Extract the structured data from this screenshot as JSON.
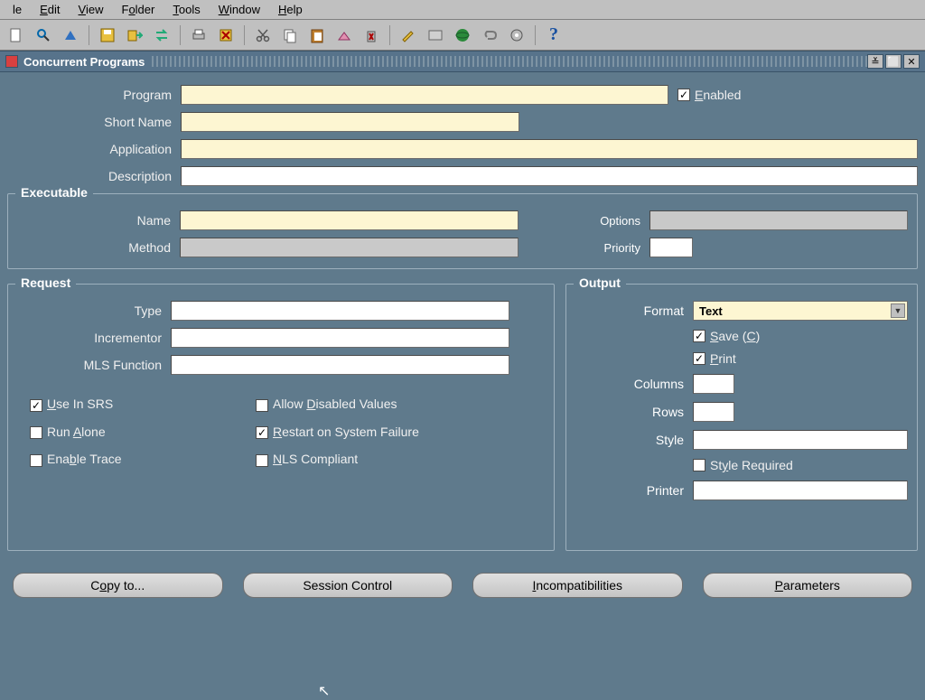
{
  "menu": {
    "file": "le",
    "edit": "Edit",
    "view": "View",
    "folder": "Folder",
    "tools": "Tools",
    "window": "Window",
    "help": "Help"
  },
  "window": {
    "title": "Concurrent Programs"
  },
  "top": {
    "program_label": "Program",
    "program_value": "",
    "enabled_label": "Enabled",
    "enabled_checked": true,
    "short_name_label": "Short Name",
    "short_name_value": "",
    "application_label": "Application",
    "application_value": "",
    "description_label": "Description",
    "description_value": ""
  },
  "executable": {
    "title": "Executable",
    "name_label": "Name",
    "name_value": "",
    "method_label": "Method",
    "method_value": "",
    "options_label": "Options",
    "options_value": "",
    "priority_label": "Priority",
    "priority_value": ""
  },
  "request": {
    "title": "Request",
    "type_label": "Type",
    "type_value": "",
    "incrementor_label": "Incrementor",
    "incrementor_value": "",
    "mls_function_label": "MLS Function",
    "mls_function_value": "",
    "use_in_srs_label": "Use In SRS",
    "use_in_srs_checked": true,
    "run_alone_label": "Run Alone",
    "run_alone_checked": false,
    "enable_trace_label": "Enable Trace",
    "enable_trace_checked": false,
    "allow_disabled_values_label": "Allow Disabled Values",
    "allow_disabled_values_checked": false,
    "restart_on_failure_label": "Restart on System Failure",
    "restart_on_failure_checked": true,
    "nls_compliant_label": "NLS Compliant",
    "nls_compliant_checked": false
  },
  "output": {
    "title": "Output",
    "format_label": "Format",
    "format_value": "Text",
    "save_label": "Save (C)",
    "save_checked": true,
    "print_label": "Print",
    "print_checked": true,
    "columns_label": "Columns",
    "columns_value": "",
    "rows_label": "Rows",
    "rows_value": "",
    "style_label": "Style",
    "style_value": "",
    "style_required_label": "Style Required",
    "style_required_checked": false,
    "printer_label": "Printer",
    "printer_value": ""
  },
  "buttons": {
    "copy_to": "Copy to...",
    "session_control": "Session Control",
    "incompatibilities": "Incompatibilities",
    "parameters": "Parameters"
  }
}
